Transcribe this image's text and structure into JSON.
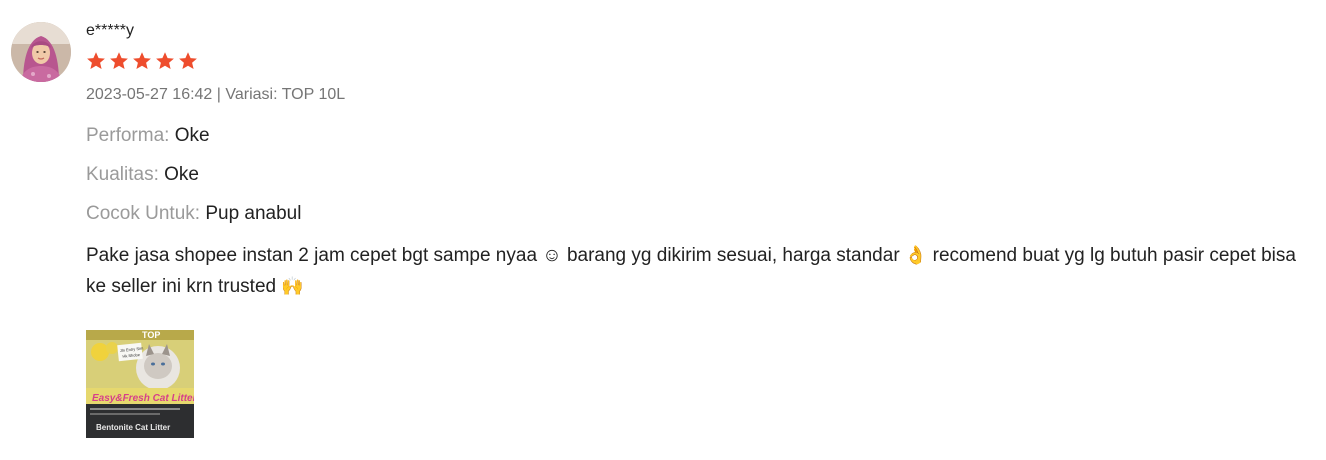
{
  "review": {
    "username": "e*****y",
    "rating": 5,
    "rating_max": 5,
    "star_color": "#ee4d2d",
    "meta": "2023-05-27 16:42 | Variasi: TOP 10L",
    "attributes": [
      {
        "key": "Performa:",
        "value": "Oke"
      },
      {
        "key": "Kualitas:",
        "value": "Oke"
      },
      {
        "key": "Cocok Untuk:",
        "value": "Pup anabul"
      }
    ],
    "comment_part1": "Pake jasa shopee instan 2 jam cepet bgt sampe nyaa ☺ barang yg dikirim sesuai, harga standar ",
    "emoji_ok": "👌",
    "comment_part2": " recomend buat yg lg butuh pasir cepet bisa ke seller ini krn trusted ",
    "emoji_hands": "🙌",
    "media": {
      "product_text": "Easy&Fresh Cat Litter",
      "sub_text": "Bentonite Cat Litter",
      "brand_text": "TOP",
      "note_text": "Jln Entry Sim\nHk Shobe"
    }
  }
}
